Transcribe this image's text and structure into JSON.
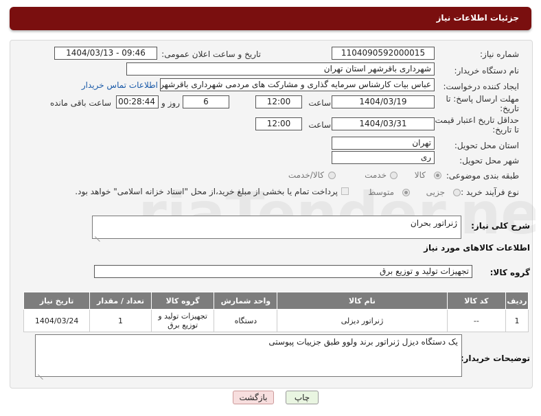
{
  "header": {
    "title": "جزئیات اطلاعات نیاز"
  },
  "fields": {
    "need_number_label": "شماره نیاز:",
    "need_number": "1104090592000015",
    "announce_label": "تاریخ و ساعت اعلان عمومی:",
    "announce_value": "1404/03/13 - 09:46",
    "buyer_org_label": "نام دستگاه خریدار:",
    "buyer_org": "شهرداری باقرشهر استان تهران",
    "creator_label": "ایجاد کننده درخواست:",
    "creator": "عباس بیات کارشناس سرمایه گذاری و مشارکت های مردمی شهرداری باقرشهر",
    "contact_link": "اطلاعات تماس خریدار",
    "deadline_label_1": "مهلت ارسال پاسخ: تا",
    "deadline_label_2": "تاریخ:",
    "deadline_date": "1404/03/19",
    "time_label": "ساعت",
    "deadline_time": "12:00",
    "days_value": "6",
    "days_label": "روز و",
    "remaining_time": "00:28:44",
    "remaining_label": "ساعت باقی مانده",
    "validity_label_1": "حداقل تاریخ اعتبار قیمت:",
    "validity_label_2": "تا تاریخ:",
    "validity_date": "1404/03/31",
    "validity_time": "12:00",
    "province_label": "استان محل تحویل:",
    "province": "تهران",
    "city_label": "شهر محل تحویل:",
    "city": "ری",
    "category_label": "طبقه بندی موضوعی:",
    "category_options": [
      "کالا",
      "خدمت",
      "کالا/خدمت"
    ],
    "process_label": "نوع فرآیند خرید :",
    "process_options": [
      "جزیی",
      "متوسط"
    ],
    "payment_note": "پرداخت تمام یا بخشی از مبلغ خرید،از محل \"اسناد خزانه اسلامی\" خواهد بود.",
    "description_label": "شرح کلی نیاز:",
    "description": "ژنراتور بحران",
    "goods_info_title": "اطلاعات کالاهای مورد نیاز",
    "goods_group_label": "گروه کالا:",
    "goods_group": "تجهیزات تولید و توزیع برق",
    "buyer_notes_label": "توضیحات خریدار:",
    "buyer_notes": "یک دستگاه دیزل ژنراتور برند ولوو طبق جزییات پیوستی"
  },
  "table": {
    "headers": [
      "ردیف",
      "کد کالا",
      "نام کالا",
      "واحد شمارش",
      "گروه کالا",
      "تعداد / مقدار",
      "تاریخ نیاز"
    ],
    "rows": [
      [
        "1",
        "--",
        "ژنراتور دیزلی",
        "دستگاه",
        "تجهیزات تولید و توزیع برق",
        "1",
        "1404/03/24"
      ]
    ]
  },
  "buttons": {
    "print": "چاپ",
    "back": "بازگشت"
  },
  "watermark": "AriaTender.neT"
}
